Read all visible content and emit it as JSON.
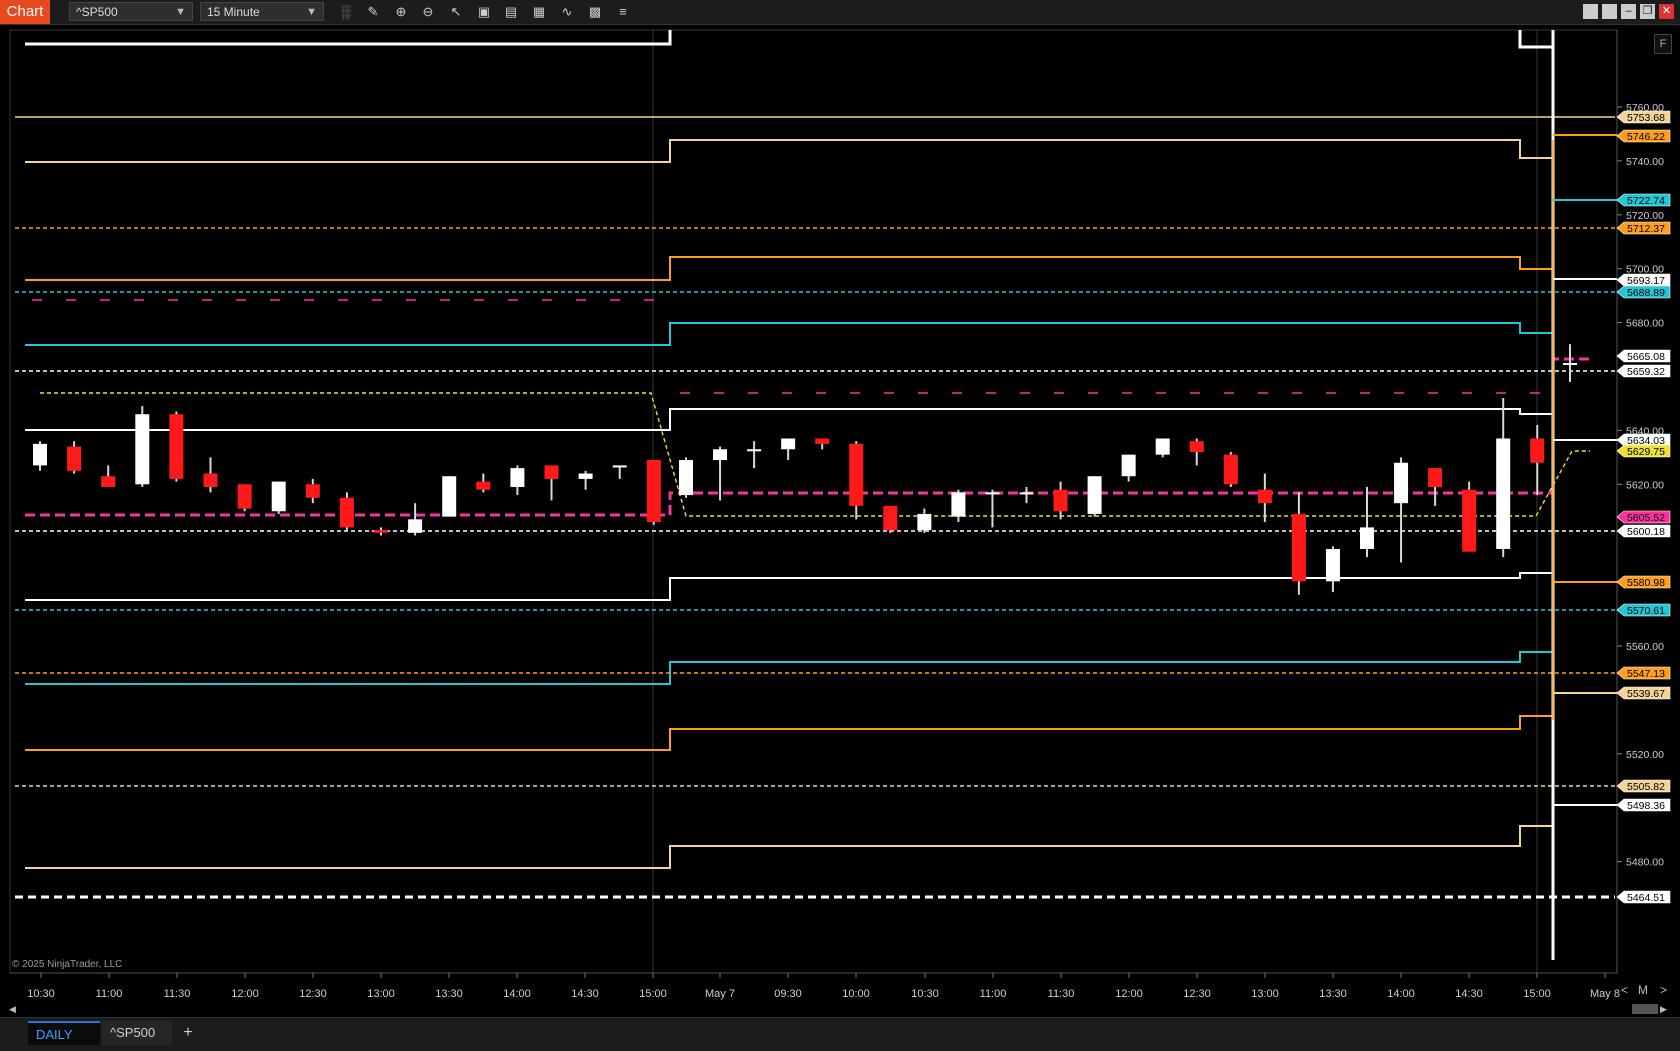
{
  "toolbar": {
    "chart_tab_label": "Chart",
    "instrument": "^SP500",
    "interval": "15 Minute",
    "tools": [
      "bar-type-icon",
      "pencil-icon",
      "zoom-in-icon",
      "zoom-out-icon",
      "pointer-icon",
      "properties-icon",
      "data-box-icon",
      "instrument-icon",
      "indicators-icon",
      "strategies-icon",
      "list-icon"
    ],
    "window_buttons": [
      "tile-icon",
      "tile-icon",
      "minimize-icon",
      "restore-icon",
      "close-icon"
    ]
  },
  "chart": {
    "copyright": "© 2025 NinjaTrader, LLC",
    "corner_button": "F",
    "nav": {
      "prev": "<",
      "mode": "M",
      "next": ">"
    },
    "x_tick_labels": [
      "10:30",
      "11:00",
      "11:30",
      "12:00",
      "12:30",
      "13:00",
      "13:30",
      "14:00",
      "14:30",
      "15:00",
      "May 7",
      "09:30",
      "10:00",
      "10:30",
      "11:00",
      "11:30",
      "12:00",
      "12:30",
      "13:00",
      "13:30",
      "14:00",
      "14:30",
      "15:00",
      "May 8"
    ],
    "y_tick_labels": [
      "5760.00",
      "5740.00",
      "5720.00",
      "5700.00",
      "5680.00",
      "5640.00",
      "5620.00",
      "5560.00",
      "5520.00",
      "5480.00"
    ],
    "price_markers": [
      {
        "label": "5753.68",
        "color": "#f5d49a"
      },
      {
        "label": "5746.22",
        "color": "#ff9e1b"
      },
      {
        "label": "5722.74",
        "color": "#22c7d6"
      },
      {
        "label": "5712.37",
        "color": "#ff9e1b"
      },
      {
        "label": "5693.17",
        "color": "#ffffff"
      },
      {
        "label": "5688.89",
        "color": "#22c7d6"
      },
      {
        "label": "5665.08",
        "color": "#ffffff"
      },
      {
        "label": "5659.32",
        "color": "#ffffff"
      },
      {
        "label": "5634.03",
        "color": "#ffffff"
      },
      {
        "label": "5629.75",
        "color": "#f0e030"
      },
      {
        "label": "5605.52",
        "color": "#ff2fa0"
      },
      {
        "label": "5600.18",
        "color": "#ffffff"
      },
      {
        "label": "5580.98",
        "color": "#ff9e1b"
      },
      {
        "label": "5570.61",
        "color": "#22c7d6"
      },
      {
        "label": "5547.13",
        "color": "#ff9e1b"
      },
      {
        "label": "5539.67",
        "color": "#f5d49a"
      },
      {
        "label": "5505.82",
        "color": "#f5d49a"
      },
      {
        "label": "5498.36",
        "color": "#ffffff"
      },
      {
        "label": "5464.51",
        "color": "#ffffff"
      }
    ],
    "colors": {
      "bull": "#ffffff",
      "bear": "#ff1a1a",
      "background": "#000000",
      "cyan": "#22c7d6",
      "orange": "#ff9e1b",
      "tan": "#f5d49a",
      "magenta": "#ff2fa0",
      "yellow": "#f0e030"
    }
  },
  "chart_data": {
    "type": "candlestick",
    "x_labels": [
      "10:30",
      "11:00",
      "11:30",
      "12:00",
      "12:30",
      "13:00",
      "13:30",
      "14:00",
      "14:30",
      "15:00",
      "May 7",
      "09:30",
      "10:00",
      "10:30",
      "11:00",
      "11:30",
      "12:00",
      "12:30",
      "13:00",
      "13:30",
      "14:00",
      "14:30",
      "15:00",
      "May 8"
    ],
    "ylim": [
      5457,
      5788
    ],
    "candles": [
      {
        "o": 5627,
        "h": 5636,
        "l": 5625,
        "c": 5635
      },
      {
        "o": 5634,
        "h": 5636,
        "l": 5624,
        "c": 5625
      },
      {
        "o": 5623,
        "h": 5627,
        "l": 5619,
        "c": 5619
      },
      {
        "o": 5620,
        "h": 5649,
        "l": 5619,
        "c": 5646
      },
      {
        "o": 5646,
        "h": 5647,
        "l": 5621,
        "c": 5622
      },
      {
        "o": 5624,
        "h": 5630,
        "l": 5617,
        "c": 5619
      },
      {
        "o": 5620,
        "h": 5620,
        "l": 5610,
        "c": 5611
      },
      {
        "o": 5610,
        "h": 5621,
        "l": 5609,
        "c": 5621
      },
      {
        "o": 5620,
        "h": 5622,
        "l": 5613,
        "c": 5615
      },
      {
        "o": 5615,
        "h": 5617,
        "l": 5603,
        "c": 5604
      },
      {
        "o": 5603,
        "h": 5604,
        "l": 5601,
        "c": 5602
      },
      {
        "o": 5602,
        "h": 5613,
        "l": 5601,
        "c": 5607
      },
      {
        "o": 5608,
        "h": 5623,
        "l": 5608,
        "c": 5623
      },
      {
        "o": 5621,
        "h": 5624,
        "l": 5617,
        "c": 5618
      },
      {
        "o": 5619,
        "h": 5627,
        "l": 5616,
        "c": 5626
      },
      {
        "o": 5627,
        "h": 5627,
        "l": 5614,
        "c": 5622
      },
      {
        "o": 5622,
        "h": 5625,
        "l": 5618,
        "c": 5624
      },
      {
        "o": 5627,
        "h": 5627,
        "l": 5622,
        "c": 5627
      },
      {
        "o": 5629,
        "h": 5629,
        "l": 5605,
        "c": 5606
      },
      {
        "o": 5616,
        "h": 5630,
        "l": 5615,
        "c": 5629
      },
      {
        "o": 5629,
        "h": 5634,
        "l": 5614,
        "c": 5633
      },
      {
        "o": 5633,
        "h": 5636,
        "l": 5626,
        "c": 5633
      },
      {
        "o": 5633,
        "h": 5637,
        "l": 5629,
        "c": 5637
      },
      {
        "o": 5637,
        "h": 5637,
        "l": 5633,
        "c": 5635
      },
      {
        "o": 5635,
        "h": 5636,
        "l": 5607,
        "c": 5612
      },
      {
        "o": 5612,
        "h": 5612,
        "l": 5602,
        "c": 5603
      },
      {
        "o": 5603,
        "h": 5611,
        "l": 5602,
        "c": 5609
      },
      {
        "o": 5608,
        "h": 5618,
        "l": 5606,
        "c": 5617
      },
      {
        "o": 5617,
        "h": 5618,
        "l": 5604,
        "c": 5617
      },
      {
        "o": 5617,
        "h": 5619,
        "l": 5613,
        "c": 5617
      },
      {
        "o": 5618,
        "h": 5621,
        "l": 5607,
        "c": 5610
      },
      {
        "o": 5609,
        "h": 5623,
        "l": 5608,
        "c": 5623
      },
      {
        "o": 5623,
        "h": 5631,
        "l": 5621,
        "c": 5631
      },
      {
        "o": 5631,
        "h": 5637,
        "l": 5630,
        "c": 5637
      },
      {
        "o": 5636,
        "h": 5637,
        "l": 5627,
        "c": 5632
      },
      {
        "o": 5631,
        "h": 5632,
        "l": 5619,
        "c": 5620
      },
      {
        "o": 5618,
        "h": 5624,
        "l": 5606,
        "c": 5613
      },
      {
        "o": 5609,
        "h": 5617,
        "l": 5579,
        "c": 5584
      },
      {
        "o": 5584,
        "h": 5597,
        "l": 5580,
        "c": 5596
      },
      {
        "o": 5596,
        "h": 5619,
        "l": 5593,
        "c": 5604
      },
      {
        "o": 5613,
        "h": 5630,
        "l": 5591,
        "c": 5628
      },
      {
        "o": 5626,
        "h": 5626,
        "l": 5612,
        "c": 5619
      },
      {
        "o": 5618,
        "h": 5621,
        "l": 5595,
        "c": 5595
      },
      {
        "o": 5596,
        "h": 5652,
        "l": 5593,
        "c": 5637
      },
      {
        "o": 5637,
        "h": 5642,
        "l": 5616,
        "c": 5628
      },
      {
        "o": 5665,
        "h": 5672,
        "l": 5658,
        "c": 5665
      }
    ]
  }
}
